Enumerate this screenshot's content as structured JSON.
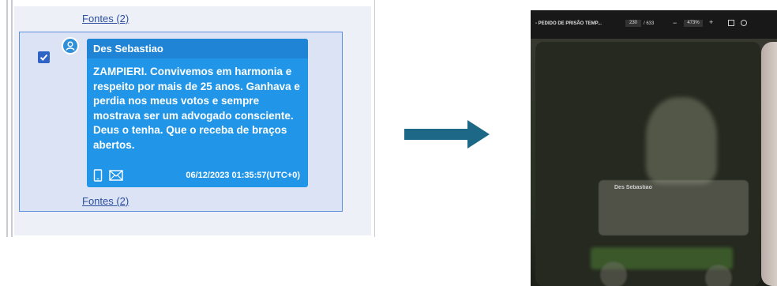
{
  "left_panel": {
    "sources_link_top": "Fontes (2)",
    "sources_link_bottom": "Fontes (2)",
    "message": {
      "checked": true,
      "sender": "Des Sebastiao",
      "text": "ZAMPIERI. Convivemos  em harmonia e respeito por mais de 25 anos. Ganhava e perdia nos meus votos e sempre mostrava ser um advogado consciente. Deus o tenha. Que o receba de braços abertos.",
      "timestamp": "06/12/2023 01:35:57(UTC+0)",
      "icons": [
        "mobile-phone-icon",
        "envelope-icon"
      ],
      "bubble_color": "#2196e8"
    }
  },
  "arrow": {
    "color": "#1d6886",
    "icon": "right-arrow-icon"
  },
  "right_photo": {
    "pdf_toolbar": {
      "title": "- PEDIDO DE PRISÃO TEMP...",
      "current_page": "230",
      "page_count": "/ 633",
      "zoom": "473%"
    },
    "visible_sender": "Des Sebastiao"
  }
}
